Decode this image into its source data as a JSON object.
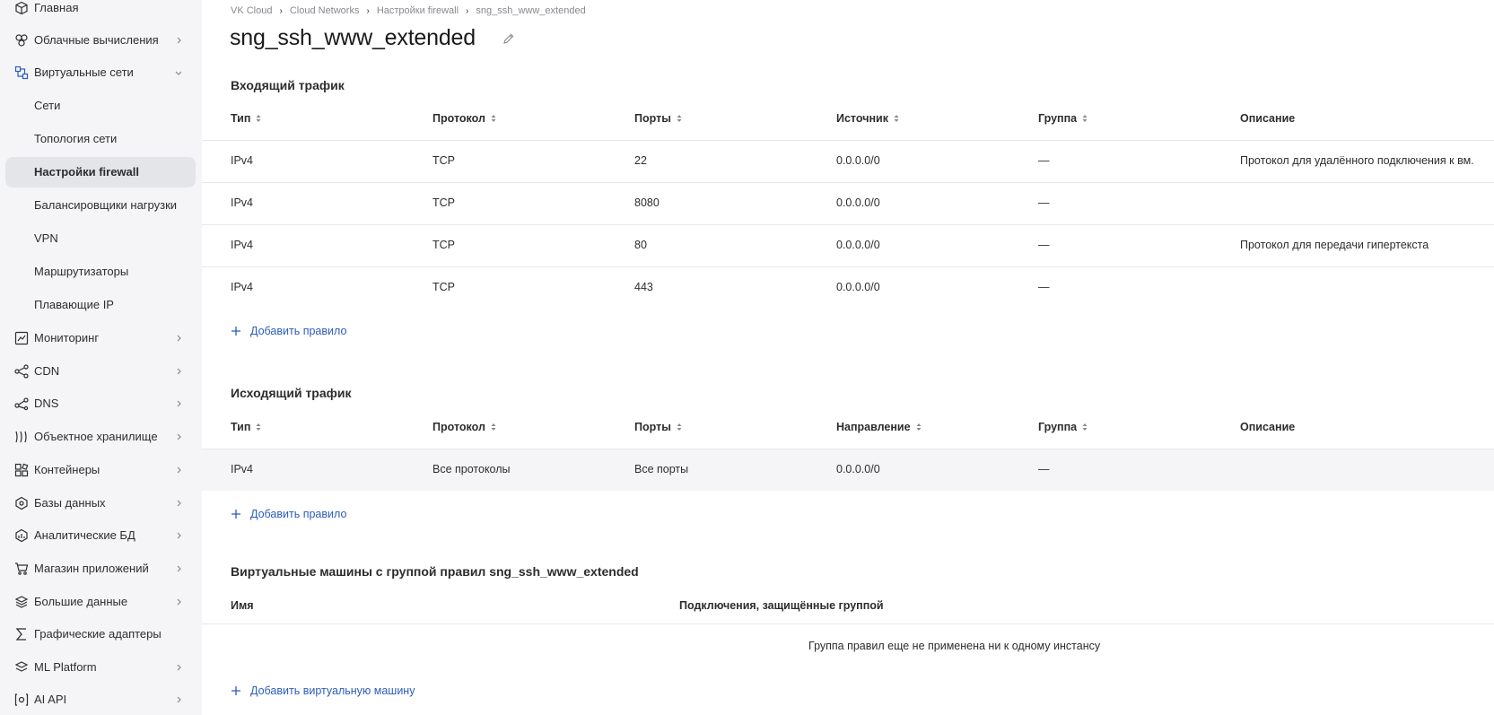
{
  "sidebar": {
    "items": [
      {
        "label": "Главная",
        "icon": "cube-icon"
      },
      {
        "label": "Облачные вычисления",
        "icon": "cloud-compute-icon"
      },
      {
        "label": "Виртуальные сети",
        "icon": "network-icon"
      },
      {
        "label": "Сети"
      },
      {
        "label": "Топология сети"
      },
      {
        "label": "Настройки firewall"
      },
      {
        "label": "Балансировщики нагрузки"
      },
      {
        "label": "VPN"
      },
      {
        "label": "Маршрутизаторы"
      },
      {
        "label": "Плавающие IP"
      },
      {
        "label": "Мониторинг",
        "icon": "chart-icon"
      },
      {
        "label": "CDN",
        "icon": "cdn-icon"
      },
      {
        "label": "DNS",
        "icon": "dns-icon"
      },
      {
        "label": "Объектное хранилище",
        "icon": "storage-icon"
      },
      {
        "label": "Контейнеры",
        "icon": "containers-icon"
      },
      {
        "label": "Базы данных",
        "icon": "database-icon"
      },
      {
        "label": "Аналитические БД",
        "icon": "analytics-db-icon"
      },
      {
        "label": "Магазин приложений",
        "icon": "cart-icon"
      },
      {
        "label": "Большие данные",
        "icon": "layers-icon"
      },
      {
        "label": "Графические адаптеры",
        "icon": "sigma-icon"
      },
      {
        "label": "ML Platform",
        "icon": "ml-icon"
      },
      {
        "label": "AI API",
        "icon": "ai-api-icon"
      }
    ]
  },
  "breadcrumb": [
    "VK Cloud",
    "Cloud Networks",
    "Настройки firewall",
    "sng_ssh_www_extended"
  ],
  "page_title": "sng_ssh_www_extended",
  "inbound": {
    "title": "Входящий трафик",
    "headers": [
      "Тип",
      "Протокол",
      "Порты",
      "Источник",
      "Группа",
      "Описание"
    ],
    "rows": [
      [
        "IPv4",
        "TCP",
        "22",
        "0.0.0.0/0",
        "—",
        "Протокол для удалённого подключения к вм."
      ],
      [
        "IPv4",
        "TCP",
        "8080",
        "0.0.0.0/0",
        "—",
        ""
      ],
      [
        "IPv4",
        "TCP",
        "80",
        "0.0.0.0/0",
        "—",
        "Протокол для передачи гипертекста"
      ],
      [
        "IPv4",
        "TCP",
        "443",
        "0.0.0.0/0",
        "—",
        ""
      ]
    ],
    "add_label": "Добавить правило"
  },
  "outbound": {
    "title": "Исходящий трафик",
    "headers": [
      "Тип",
      "Протокол",
      "Порты",
      "Направление",
      "Группа",
      "Описание"
    ],
    "rows": [
      [
        "IPv4",
        "Все протоколы",
        "Все порты",
        "0.0.0.0/0",
        "—",
        ""
      ]
    ],
    "add_label": "Добавить правило"
  },
  "vms": {
    "title": "Виртуальные машины с группой правил sng_ssh_www_extended",
    "headers": [
      "Имя",
      "Подключения, защищённые группой"
    ],
    "empty": "Группа правил еще не применена ни к одному инстансу",
    "add_label": "Добавить виртуальную машину"
  },
  "colors": {
    "accent": "#2d5cba",
    "sidebar_bg": "#f5f5f7",
    "active_bg": "#e4e5e9"
  }
}
